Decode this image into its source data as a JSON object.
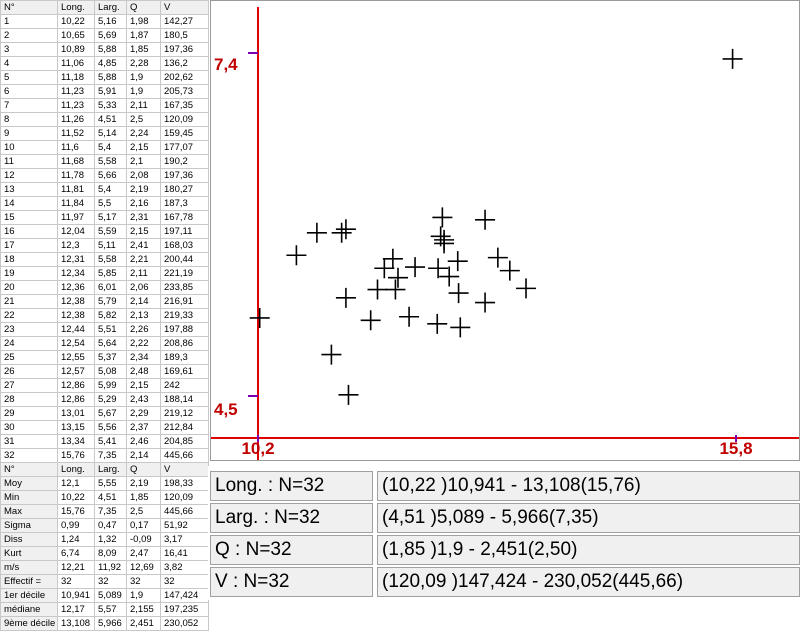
{
  "table": {
    "header": [
      "N°",
      "Long.",
      "Larg.",
      "Q",
      "V"
    ],
    "rows": [
      [
        "1",
        "10,22",
        "5,16",
        "1,98",
        "142,27"
      ],
      [
        "2",
        "10,65",
        "5,69",
        "1,87",
        "180,5"
      ],
      [
        "3",
        "10,89",
        "5,88",
        "1,85",
        "197,36"
      ],
      [
        "4",
        "11,06",
        "4,85",
        "2,28",
        "136,2"
      ],
      [
        "5",
        "11,18",
        "5,88",
        "1,9",
        "202,62"
      ],
      [
        "6",
        "11,23",
        "5,91",
        "1,9",
        "205,73"
      ],
      [
        "7",
        "11,23",
        "5,33",
        "2,11",
        "167,35"
      ],
      [
        "8",
        "11,26",
        "4,51",
        "2,5",
        "120,09"
      ],
      [
        "9",
        "11,52",
        "5,14",
        "2,24",
        "159,45"
      ],
      [
        "10",
        "11,6",
        "5,4",
        "2,15",
        "177,07"
      ],
      [
        "11",
        "11,68",
        "5,58",
        "2,1",
        "190,2"
      ],
      [
        "12",
        "11,78",
        "5,66",
        "2,08",
        "197,36"
      ],
      [
        "13",
        "11,81",
        "5,4",
        "2,19",
        "180,27"
      ],
      [
        "14",
        "11,84",
        "5,5",
        "2,16",
        "187,3"
      ],
      [
        "15",
        "11,97",
        "5,17",
        "2,31",
        "167,78"
      ],
      [
        "16",
        "12,04",
        "5,59",
        "2,15",
        "197,11"
      ],
      [
        "17",
        "12,3",
        "5,11",
        "2,41",
        "168,03"
      ],
      [
        "18",
        "12,31",
        "5,58",
        "2,21",
        "200,44"
      ],
      [
        "19",
        "12,34",
        "5,85",
        "2,11",
        "221,19"
      ],
      [
        "20",
        "12,36",
        "6,01",
        "2,06",
        "233,85"
      ],
      [
        "21",
        "12,38",
        "5,79",
        "2,14",
        "216,91"
      ],
      [
        "22",
        "12,38",
        "5,82",
        "2,13",
        "219,33"
      ],
      [
        "23",
        "12,44",
        "5,51",
        "2,26",
        "197,88"
      ],
      [
        "24",
        "12,54",
        "5,64",
        "2,22",
        "208,86"
      ],
      [
        "25",
        "12,55",
        "5,37",
        "2,34",
        "189,3"
      ],
      [
        "26",
        "12,57",
        "5,08",
        "2,48",
        "169,61"
      ],
      [
        "27",
        "12,86",
        "5,99",
        "2,15",
        "242"
      ],
      [
        "28",
        "12,86",
        "5,29",
        "2,43",
        "188,14"
      ],
      [
        "29",
        "13,01",
        "5,67",
        "2,29",
        "219,12"
      ],
      [
        "30",
        "13,15",
        "5,56",
        "2,37",
        "212,84"
      ],
      [
        "31",
        "13,34",
        "5,41",
        "2,46",
        "204,85"
      ],
      [
        "32",
        "15,76",
        "7,35",
        "2,14",
        "445,66"
      ]
    ],
    "stats_header": [
      "N°",
      "Long.",
      "Larg.",
      "Q",
      "V"
    ],
    "stats": [
      [
        "Moy",
        "12,1",
        "5,55",
        "2,19",
        "198,33"
      ],
      [
        "Min",
        "10,22",
        "4,51",
        "1,85",
        "120,09"
      ],
      [
        "Max",
        "15,76",
        "7,35",
        "2,5",
        "445,66"
      ],
      [
        "Sigma",
        "0,99",
        "0,47",
        "0,17",
        "51,92"
      ],
      [
        "Diss",
        "1,24",
        "1,32",
        "-0,09",
        "3,17"
      ],
      [
        "Kurt",
        "6,74",
        "8,09",
        "2,47",
        "16,41"
      ],
      [
        "m/s",
        "12,21",
        "11,92",
        "12,69",
        "3,82"
      ],
      [
        "Effectif =",
        "32",
        "32",
        "32",
        "32"
      ],
      [
        "1er décile",
        "10,941",
        "5,089",
        "1,9",
        "147,424"
      ],
      [
        "médiane",
        "12,17",
        "5,57",
        "2,155",
        "197,235"
      ],
      [
        "9ème décile",
        "13,108",
        "5,966",
        "2,451",
        "230,052"
      ]
    ]
  },
  "summary": [
    {
      "label": "Long. : N=32",
      "range": "(10,22 )10,941 - 13,108(15,76)"
    },
    {
      "label": "Larg. : N=32",
      "range": "(4,51 )5,089 - 5,966(7,35)"
    },
    {
      "label": "Q : N=32",
      "range": "(1,85 )1,9 - 2,451(2,50)"
    },
    {
      "label": "V : N=32",
      "range": "(120,09 )147,424 - 230,052(445,66)"
    }
  ],
  "colors": {
    "axis": "#e00000",
    "marker": "#000000",
    "tick_label": "#c00000"
  },
  "chart_data": {
    "type": "scatter",
    "xlabel": "",
    "ylabel": "",
    "xlim": [
      10.2,
      15.8
    ],
    "ylim": [
      4.5,
      7.4
    ],
    "x_tick_labels": [
      "10,2",
      "15,8"
    ],
    "y_tick_labels": [
      "4,5",
      "7,4"
    ],
    "points": [
      [
        10.22,
        5.16
      ],
      [
        10.65,
        5.69
      ],
      [
        10.89,
        5.88
      ],
      [
        11.06,
        4.85
      ],
      [
        11.18,
        5.88
      ],
      [
        11.23,
        5.91
      ],
      [
        11.23,
        5.33
      ],
      [
        11.26,
        4.51
      ],
      [
        11.52,
        5.14
      ],
      [
        11.6,
        5.4
      ],
      [
        11.68,
        5.58
      ],
      [
        11.78,
        5.66
      ],
      [
        11.81,
        5.4
      ],
      [
        11.84,
        5.5
      ],
      [
        11.97,
        5.17
      ],
      [
        12.04,
        5.59
      ],
      [
        12.3,
        5.11
      ],
      [
        12.31,
        5.58
      ],
      [
        12.34,
        5.85
      ],
      [
        12.36,
        6.01
      ],
      [
        12.38,
        5.79
      ],
      [
        12.38,
        5.82
      ],
      [
        12.44,
        5.51
      ],
      [
        12.54,
        5.64
      ],
      [
        12.55,
        5.37
      ],
      [
        12.57,
        5.08
      ],
      [
        12.86,
        5.99
      ],
      [
        12.86,
        5.29
      ],
      [
        13.01,
        5.67
      ],
      [
        13.15,
        5.56
      ],
      [
        13.34,
        5.41
      ],
      [
        15.76,
        7.35
      ]
    ]
  }
}
